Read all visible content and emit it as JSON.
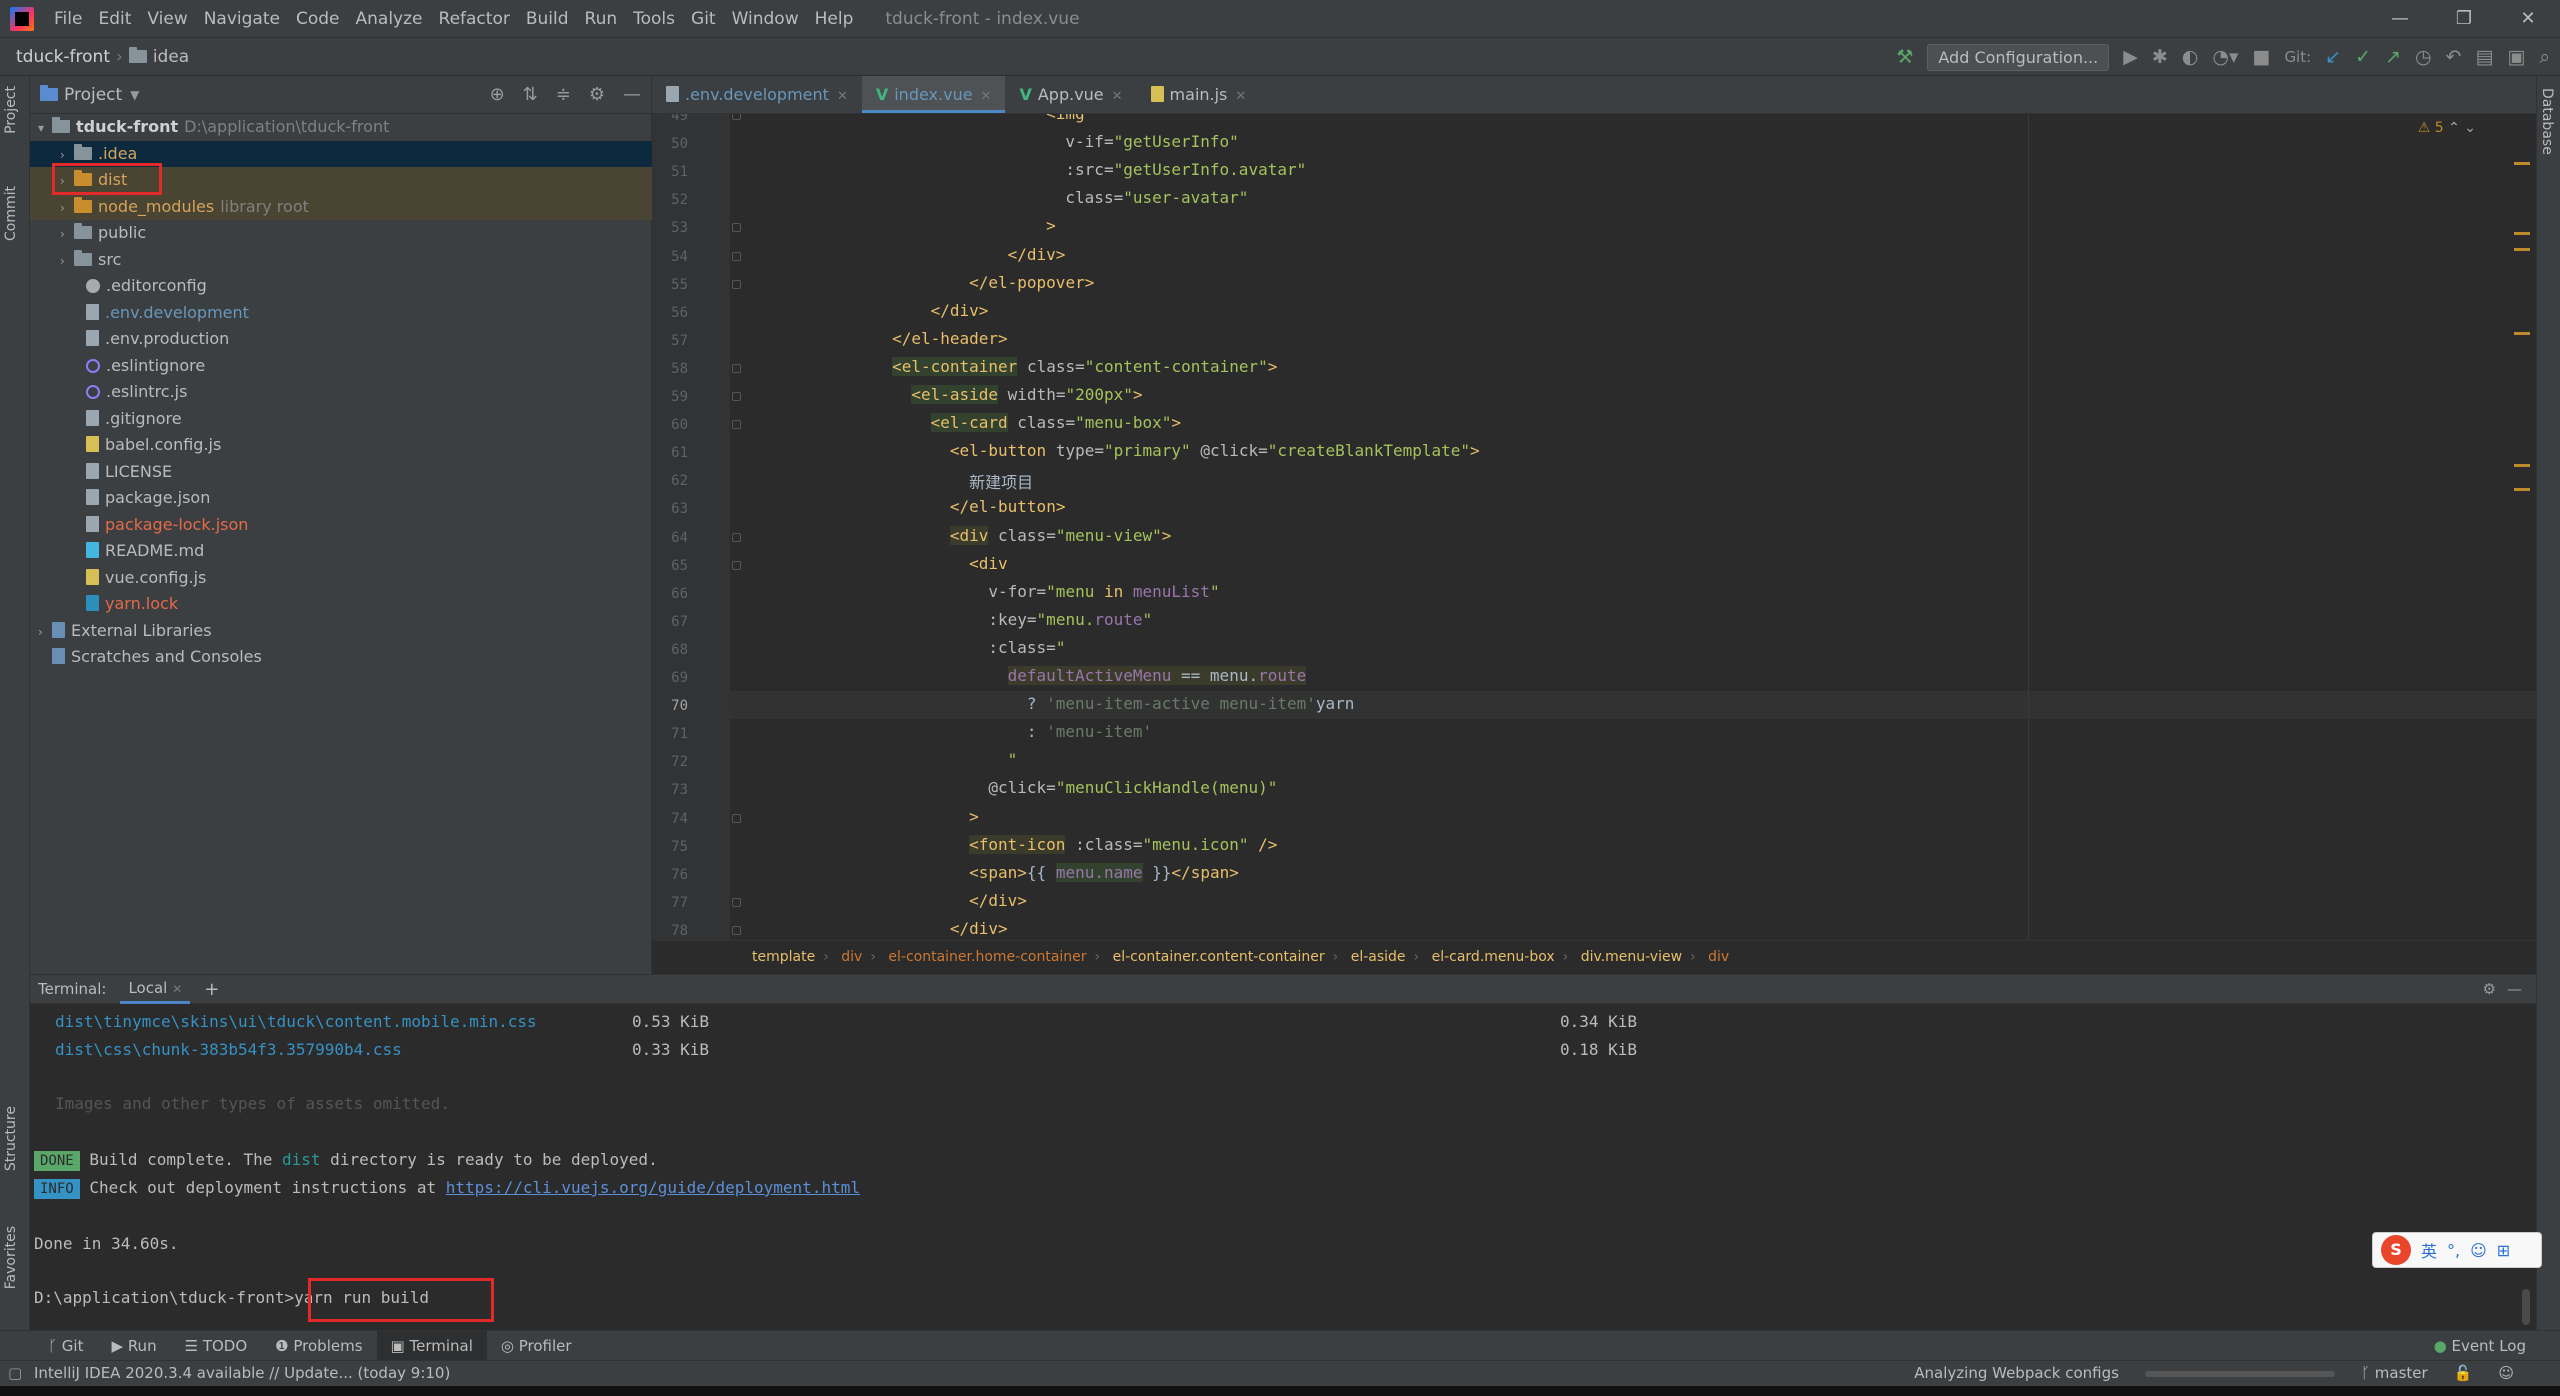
{
  "menubar": {
    "items": [
      "File",
      "Edit",
      "View",
      "Navigate",
      "Code",
      "Analyze",
      "Refactor",
      "Build",
      "Run",
      "Tools",
      "Git",
      "Window",
      "Help"
    ],
    "window_title": "tduck-front - index.vue"
  },
  "navbar": {
    "project": "tduck-front",
    "folder": "idea",
    "add_configuration": "Add Configuration...",
    "git_label": "Git:"
  },
  "left_stripe": {
    "project": "Project",
    "commit": "Commit",
    "structure": "Structure",
    "favorites": "Favorites"
  },
  "right_stripe": {
    "database": "Database"
  },
  "project_panel": {
    "title": "Project",
    "root_name": "tduck-front",
    "root_path": "D:\\application\\tduck-front",
    "items": {
      "idea": ".idea",
      "dist": "dist",
      "node_modules": "node_modules",
      "node_modules_note": "library root",
      "public": "public",
      "src": "src",
      "editorconfig": ".editorconfig",
      "env_development": ".env.development",
      "env_production": ".env.production",
      "eslintignore": ".eslintignore",
      "eslintrc": ".eslintrc.js",
      "gitignore": ".gitignore",
      "babel": "babel.config.js",
      "license": "LICENSE",
      "package_json": "package.json",
      "package_lock": "package-lock.json",
      "readme": "README.md",
      "vue_config": "vue.config.js",
      "yarn_lock": "yarn.lock",
      "external_libraries": "External Libraries",
      "scratches": "Scratches and Consoles"
    }
  },
  "editor_tabs": [
    ".env.development",
    "index.vue",
    "App.vue",
    "main.js"
  ],
  "editor": {
    "warning_count": "5",
    "line_numbers": [
      "49",
      "50",
      "51",
      "52",
      "53",
      "54",
      "55",
      "56",
      "57",
      "58",
      "59",
      "60",
      "61",
      "62",
      "63",
      "64",
      "65",
      "66",
      "67",
      "68",
      "69",
      "70",
      "71",
      "72",
      "73",
      "74",
      "75",
      "76",
      "77",
      "78"
    ],
    "current_line": "70",
    "code": {
      "l49": "<img",
      "l50_attr": "v-if=",
      "l50_val": "\"getUserInfo\"",
      "l51_attr": ":src=",
      "l51_val": "\"getUserInfo.avatar\"",
      "l52_attr": "class=",
      "l52_val": "\"user-avatar\"",
      "l53": ">",
      "l54": "</div>",
      "l55": "</el-popover>",
      "l56": "</div>",
      "l57": "</el-header>",
      "l58_tag": "<el-container",
      "l58_attr": " class=",
      "l58_val": "\"content-container\"",
      "l58_end": ">",
      "l59_tag": "<el-aside",
      "l59_attr": " width=",
      "l59_val": "\"200px\"",
      "l59_end": ">",
      "l60_tag": "<el-card",
      "l60_attr": " class=",
      "l60_val": "\"menu-box\"",
      "l60_end": ">",
      "l61_tag": "<el-button",
      "l61_attr1": " type=",
      "l61_val1": "\"primary\"",
      "l61_attr2": " @click=",
      "l61_val2": "\"createBlankTemplate\"",
      "l61_end": ">",
      "l62": "新建项目",
      "l63": "</el-button>",
      "l64_tag": "<div",
      "l64_attr": " class=",
      "l64_val": "\"menu-view\"",
      "l64_end": ">",
      "l65": "<div",
      "l66_attr": "v-for=",
      "l66_q1": "\"menu ",
      "l66_in": "in",
      "l66_list": " menuList",
      "l66_q2": "\"",
      "l67_attr": ":key=",
      "l67_q1": "\"menu.",
      "l67_prop": "route",
      "l67_q2": "\"",
      "l68_attr": ":class=",
      "l68_val": "\"",
      "l69_a": "defaultActiveMenu",
      "l69_b": " == menu.",
      "l69_c": "route",
      "l70_q": "? ",
      "l70_s": "'menu-item-active menu-item'",
      "l70_extra": "yarn",
      "l71_c": ": ",
      "l71_s": "'menu-item'",
      "l72": "\"",
      "l73_attr": "@click=",
      "l73_val": "\"menuClickHandle(menu)\"",
      "l74": ">",
      "l75_tag": "<font-icon",
      "l75_attr": " :class=",
      "l75_val": "\"menu.icon\"",
      "l75_end": " />",
      "l76_a": "<span>",
      "l76_b": "{{ ",
      "l76_c": "menu.name",
      "l76_d": " }}",
      "l76_e": "</span>",
      "l77": "</div>",
      "l78": "</div>"
    }
  },
  "breadcrumb": [
    "template",
    "div",
    "el-container.home-container",
    "el-container.content-container",
    "el-aside",
    "el-card.menu-box",
    "div.menu-view",
    "div"
  ],
  "terminal": {
    "label": "Terminal:",
    "tab": "Local",
    "lines": {
      "f1_name": "dist\\tinymce\\skins\\ui\\tduck\\content.mobile.min.css",
      "f1_size": "0.53 KiB",
      "f1_gz": "0.34 KiB",
      "f2_name": "dist\\css\\chunk-383b54f3.357990b4.css",
      "f2_size": "0.33 KiB",
      "f2_gz": "0.18 KiB",
      "omitted": "Images and other types of assets omitted.",
      "done_badge": "DONE",
      "done_a": " Build complete. The ",
      "done_dist": "dist",
      "done_b": " directory is ready to be deployed.",
      "info_badge": "INFO",
      "info_a": " Check out deployment instructions at ",
      "info_link": "https://cli.vuejs.org/guide/deployment.html",
      "done_in": "Done in 34.60s.",
      "prompt": "D:\\application\\tduck-front>",
      "command": "yarn run build"
    }
  },
  "ime": {
    "logo": "S",
    "lang": "英"
  },
  "tool_tabs": [
    "Git",
    "Run",
    "TODO",
    "Problems",
    "Terminal",
    "Profiler"
  ],
  "event_log": "Event Log",
  "status": {
    "left": "IntelliJ IDEA 2020.3.4 available // Update... (today 9:10)",
    "task": "Analyzing Webpack configs",
    "branch": "master"
  }
}
